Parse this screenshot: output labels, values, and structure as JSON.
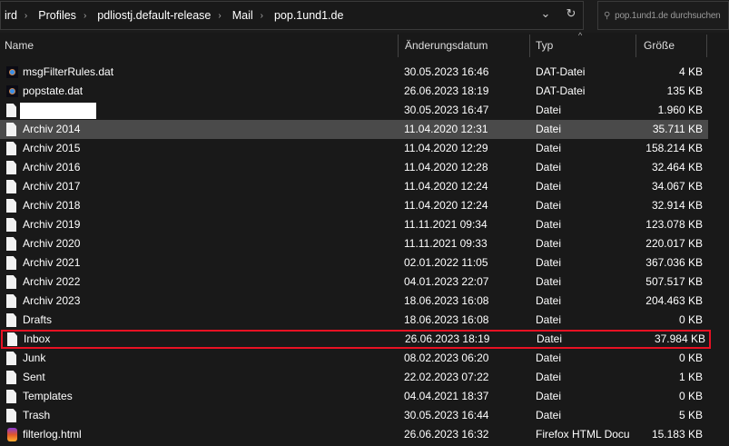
{
  "breadcrumb": [
    "ird",
    "Profiles",
    "pdliostj.default-release",
    "Mail",
    "pop.1und1.de"
  ],
  "search": {
    "placeholder": "pop.1und1.de durchsuchen"
  },
  "columns": {
    "name": "Name",
    "date": "Änderungsdatum",
    "type": "Typ",
    "size": "Größe"
  },
  "files": [
    {
      "name": "msgFilterRules.dat",
      "date": "30.05.2023 16:46",
      "type": "DAT-Datei",
      "size": "4 KB",
      "icon": "dat-file-icon"
    },
    {
      "name": "popstate.dat",
      "date": "26.06.2023 18:19",
      "type": "DAT-Datei",
      "size": "135 KB",
      "icon": "dat-file-icon"
    },
    {
      "name": "",
      "date": "30.05.2023 16:47",
      "type": "Datei",
      "size": "1.960 KB",
      "icon": "file-icon",
      "redacted": true
    },
    {
      "name": "Archiv 2014",
      "date": "11.04.2020 12:31",
      "type": "Datei",
      "size": "35.711 KB",
      "icon": "file-icon",
      "selected": true
    },
    {
      "name": "Archiv 2015",
      "date": "11.04.2020 12:29",
      "type": "Datei",
      "size": "158.214 KB",
      "icon": "file-icon"
    },
    {
      "name": "Archiv 2016",
      "date": "11.04.2020 12:28",
      "type": "Datei",
      "size": "32.464 KB",
      "icon": "file-icon"
    },
    {
      "name": "Archiv 2017",
      "date": "11.04.2020 12:24",
      "type": "Datei",
      "size": "34.067 KB",
      "icon": "file-icon"
    },
    {
      "name": "Archiv 2018",
      "date": "11.04.2020 12:24",
      "type": "Datei",
      "size": "32.914 KB",
      "icon": "file-icon"
    },
    {
      "name": "Archiv 2019",
      "date": "11.11.2021 09:34",
      "type": "Datei",
      "size": "123.078 KB",
      "icon": "file-icon"
    },
    {
      "name": "Archiv 2020",
      "date": "11.11.2021 09:33",
      "type": "Datei",
      "size": "220.017 KB",
      "icon": "file-icon"
    },
    {
      "name": "Archiv 2021",
      "date": "02.01.2022 11:05",
      "type": "Datei",
      "size": "367.036 KB",
      "icon": "file-icon"
    },
    {
      "name": "Archiv 2022",
      "date": "04.01.2023 22:07",
      "type": "Datei",
      "size": "507.517 KB",
      "icon": "file-icon"
    },
    {
      "name": "Archiv 2023",
      "date": "18.06.2023 16:08",
      "type": "Datei",
      "size": "204.463 KB",
      "icon": "file-icon"
    },
    {
      "name": "Drafts",
      "date": "18.06.2023 16:08",
      "type": "Datei",
      "size": "0 KB",
      "icon": "file-icon"
    },
    {
      "name": "Inbox",
      "date": "26.06.2023 18:19",
      "type": "Datei",
      "size": "37.984 KB",
      "icon": "file-icon",
      "highlighted": true
    },
    {
      "name": "Junk",
      "date": "08.02.2023 06:20",
      "type": "Datei",
      "size": "0 KB",
      "icon": "file-icon"
    },
    {
      "name": "Sent",
      "date": "22.02.2023 07:22",
      "type": "Datei",
      "size": "1 KB",
      "icon": "file-icon"
    },
    {
      "name": "Templates",
      "date": "04.04.2021 18:37",
      "type": "Datei",
      "size": "0 KB",
      "icon": "file-icon"
    },
    {
      "name": "Trash",
      "date": "30.05.2023 16:44",
      "type": "Datei",
      "size": "5 KB",
      "icon": "file-icon"
    },
    {
      "name": "filterlog.html",
      "date": "26.06.2023 16:32",
      "type": "Firefox HTML Document",
      "size": "15.183 KB",
      "icon": "firefox-html-icon"
    }
  ],
  "colors": {
    "highlight": "#e81123",
    "selected": "#4a4a4a"
  }
}
